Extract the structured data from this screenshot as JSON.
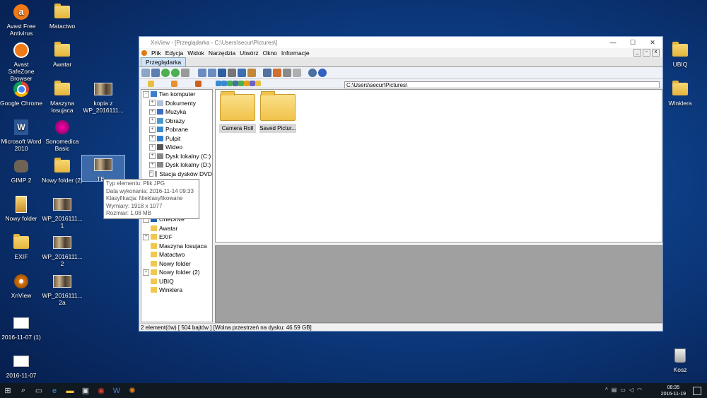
{
  "desktop": {
    "icons": [
      {
        "label": "Avast Free Antivirus",
        "icon": "avast-icon"
      },
      {
        "label": "Matactwo",
        "icon": "folder-icon"
      },
      {
        "label": "Avast SafeZone Browser",
        "icon": "avast-safezone-icon"
      },
      {
        "label": "Awatar",
        "icon": "folder-icon"
      },
      {
        "label": "Google Chrome",
        "icon": "chrome-icon"
      },
      {
        "label": "Maszyna losujaca",
        "icon": "folder-icon"
      },
      {
        "label": "kopia z WP_2016111...",
        "icon": "photo-icon"
      },
      {
        "label": "Microsoft Word 2010",
        "icon": "word-icon"
      },
      {
        "label": "Sonomedica Basic",
        "icon": "sonomedica-icon"
      },
      {
        "label": "GIMP 2",
        "icon": "gimp-icon"
      },
      {
        "label": "Nowy folder (2)",
        "icon": "folder-icon"
      },
      {
        "label": "TE...",
        "icon": "photo-icon"
      },
      {
        "label": "Nowy folder",
        "icon": "folder-icon"
      },
      {
        "label": "WP_2016111... 1",
        "icon": "photo-icon"
      },
      {
        "label": "EXIF",
        "icon": "folder-icon"
      },
      {
        "label": "WP_2016111... 2",
        "icon": "photo-icon"
      },
      {
        "label": "XnView",
        "icon": "xnview-icon"
      },
      {
        "label": "WP_2016111... 2a",
        "icon": "photo-icon"
      },
      {
        "label": "2016-11-07 (1)",
        "icon": "document-icon"
      },
      {
        "label": "2016-11-07",
        "icon": "document-icon"
      },
      {
        "label": "UBIQ",
        "icon": "folder-icon"
      },
      {
        "label": "Winklera",
        "icon": "folder-icon"
      },
      {
        "label": "Kosz",
        "icon": "recycle-bin-icon"
      }
    ]
  },
  "window": {
    "title": "XnView - [Przeglądarka - C:\\Users\\secur\\Pictures\\]",
    "menu": [
      "Plik",
      "Edycja",
      "Widok",
      "Narzędzia",
      "Utwórz",
      "Okno",
      "Informacje"
    ],
    "tab": "Przeglądarka",
    "address": "C:\\Users\\secur\\Pictures\\",
    "tree": [
      {
        "label": "Ten komputer",
        "icon": "computer-icon",
        "expander": "-",
        "indent": 0
      },
      {
        "label": "Dokumenty",
        "icon": "documents-icon",
        "expander": "+",
        "indent": 1
      },
      {
        "label": "Muzyka",
        "icon": "music-icon",
        "expander": "+",
        "indent": 1
      },
      {
        "label": "Obrazy",
        "icon": "pictures-icon",
        "expander": "+",
        "indent": 1
      },
      {
        "label": "Pobrane",
        "icon": "download-icon",
        "expander": "+",
        "indent": 1
      },
      {
        "label": "Pulpit",
        "icon": "desktop-icon",
        "expander": "+",
        "indent": 1
      },
      {
        "label": "Wideo",
        "icon": "video-icon",
        "expander": "+",
        "indent": 1
      },
      {
        "label": "Dysk lokalny (C:)",
        "icon": "drive-icon",
        "expander": "+",
        "indent": 1
      },
      {
        "label": "Dysk lokalny (D:)",
        "icon": "drive-icon",
        "expander": "+",
        "indent": 1
      },
      {
        "label": "Stacja dysków DVD",
        "icon": "dvd-icon",
        "expander": "+",
        "indent": 1
      },
      {
        "label": "OneDrive",
        "icon": "onedrive-icon",
        "expander": "+",
        "indent": 0
      },
      {
        "label": "Awatar",
        "icon": "folder-icon",
        "expander": "",
        "indent": 0
      },
      {
        "label": "EXIF",
        "icon": "folder-icon",
        "expander": "+",
        "indent": 0
      },
      {
        "label": "Maszyna losujaca",
        "icon": "folder-icon",
        "expander": "",
        "indent": 0
      },
      {
        "label": "Matactwo",
        "icon": "folder-icon",
        "expander": "",
        "indent": 0
      },
      {
        "label": "Nowy folder",
        "icon": "folder-icon",
        "expander": "",
        "indent": 0
      },
      {
        "label": "Nowy folder (2)",
        "icon": "folder-icon",
        "expander": "+",
        "indent": 0
      },
      {
        "label": "UBIQ",
        "icon": "folder-icon",
        "expander": "",
        "indent": 0
      },
      {
        "label": "Winklera",
        "icon": "folder-icon",
        "expander": "",
        "indent": 0
      }
    ],
    "files": [
      {
        "label": "Camera Roll"
      },
      {
        "label": "Saved Pictur..."
      }
    ],
    "status": "2 element(ów) [ 504 bajtów ] [Wolna przestrzeń na dysku: 46.59 GB]"
  },
  "tooltip": [
    "Typ elementu: Plik JPG",
    "Data wykonania: 2016-11-14 09:33",
    "Klasyfikacja: Nieklasyfikowane",
    "Wymiary: 1918 x 1077",
    "Rozmiar: 1,08 MB"
  ],
  "taskbar": {
    "time": "08:35",
    "date": "2016-11-19"
  }
}
